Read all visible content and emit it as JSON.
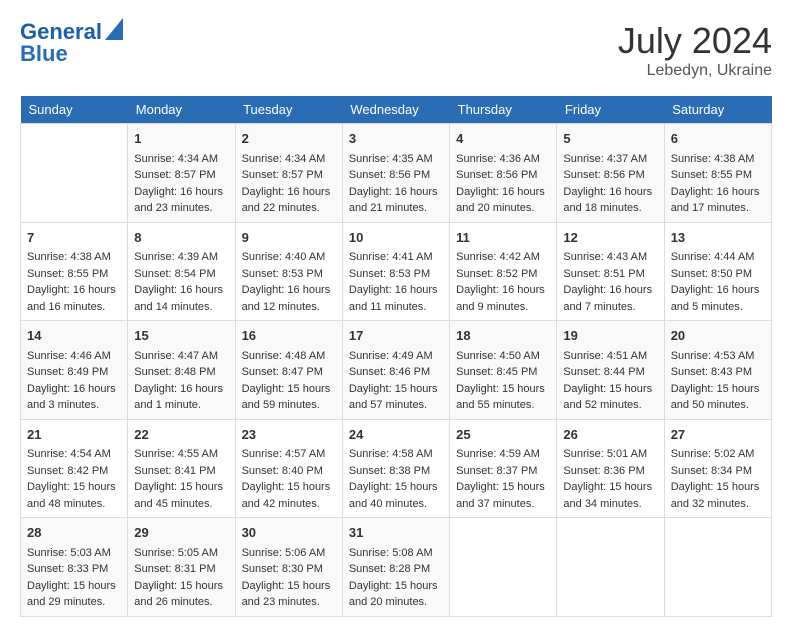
{
  "header": {
    "logo_line1": "General",
    "logo_line2": "Blue",
    "month_year": "July 2024",
    "location": "Lebedyn, Ukraine"
  },
  "calendar": {
    "days_of_week": [
      "Sunday",
      "Monday",
      "Tuesday",
      "Wednesday",
      "Thursday",
      "Friday",
      "Saturday"
    ],
    "weeks": [
      [
        {
          "day": "",
          "sunrise": "",
          "sunset": "",
          "daylight": ""
        },
        {
          "day": "1",
          "sunrise": "Sunrise: 4:34 AM",
          "sunset": "Sunset: 8:57 PM",
          "daylight": "Daylight: 16 hours and 23 minutes."
        },
        {
          "day": "2",
          "sunrise": "Sunrise: 4:34 AM",
          "sunset": "Sunset: 8:57 PM",
          "daylight": "Daylight: 16 hours and 22 minutes."
        },
        {
          "day": "3",
          "sunrise": "Sunrise: 4:35 AM",
          "sunset": "Sunset: 8:56 PM",
          "daylight": "Daylight: 16 hours and 21 minutes."
        },
        {
          "day": "4",
          "sunrise": "Sunrise: 4:36 AM",
          "sunset": "Sunset: 8:56 PM",
          "daylight": "Daylight: 16 hours and 20 minutes."
        },
        {
          "day": "5",
          "sunrise": "Sunrise: 4:37 AM",
          "sunset": "Sunset: 8:56 PM",
          "daylight": "Daylight: 16 hours and 18 minutes."
        },
        {
          "day": "6",
          "sunrise": "Sunrise: 4:38 AM",
          "sunset": "Sunset: 8:55 PM",
          "daylight": "Daylight: 16 hours and 17 minutes."
        }
      ],
      [
        {
          "day": "7",
          "sunrise": "Sunrise: 4:38 AM",
          "sunset": "Sunset: 8:55 PM",
          "daylight": "Daylight: 16 hours and 16 minutes."
        },
        {
          "day": "8",
          "sunrise": "Sunrise: 4:39 AM",
          "sunset": "Sunset: 8:54 PM",
          "daylight": "Daylight: 16 hours and 14 minutes."
        },
        {
          "day": "9",
          "sunrise": "Sunrise: 4:40 AM",
          "sunset": "Sunset: 8:53 PM",
          "daylight": "Daylight: 16 hours and 12 minutes."
        },
        {
          "day": "10",
          "sunrise": "Sunrise: 4:41 AM",
          "sunset": "Sunset: 8:53 PM",
          "daylight": "Daylight: 16 hours and 11 minutes."
        },
        {
          "day": "11",
          "sunrise": "Sunrise: 4:42 AM",
          "sunset": "Sunset: 8:52 PM",
          "daylight": "Daylight: 16 hours and 9 minutes."
        },
        {
          "day": "12",
          "sunrise": "Sunrise: 4:43 AM",
          "sunset": "Sunset: 8:51 PM",
          "daylight": "Daylight: 16 hours and 7 minutes."
        },
        {
          "day": "13",
          "sunrise": "Sunrise: 4:44 AM",
          "sunset": "Sunset: 8:50 PM",
          "daylight": "Daylight: 16 hours and 5 minutes."
        }
      ],
      [
        {
          "day": "14",
          "sunrise": "Sunrise: 4:46 AM",
          "sunset": "Sunset: 8:49 PM",
          "daylight": "Daylight: 16 hours and 3 minutes."
        },
        {
          "day": "15",
          "sunrise": "Sunrise: 4:47 AM",
          "sunset": "Sunset: 8:48 PM",
          "daylight": "Daylight: 16 hours and 1 minute."
        },
        {
          "day": "16",
          "sunrise": "Sunrise: 4:48 AM",
          "sunset": "Sunset: 8:47 PM",
          "daylight": "Daylight: 15 hours and 59 minutes."
        },
        {
          "day": "17",
          "sunrise": "Sunrise: 4:49 AM",
          "sunset": "Sunset: 8:46 PM",
          "daylight": "Daylight: 15 hours and 57 minutes."
        },
        {
          "day": "18",
          "sunrise": "Sunrise: 4:50 AM",
          "sunset": "Sunset: 8:45 PM",
          "daylight": "Daylight: 15 hours and 55 minutes."
        },
        {
          "day": "19",
          "sunrise": "Sunrise: 4:51 AM",
          "sunset": "Sunset: 8:44 PM",
          "daylight": "Daylight: 15 hours and 52 minutes."
        },
        {
          "day": "20",
          "sunrise": "Sunrise: 4:53 AM",
          "sunset": "Sunset: 8:43 PM",
          "daylight": "Daylight: 15 hours and 50 minutes."
        }
      ],
      [
        {
          "day": "21",
          "sunrise": "Sunrise: 4:54 AM",
          "sunset": "Sunset: 8:42 PM",
          "daylight": "Daylight: 15 hours and 48 minutes."
        },
        {
          "day": "22",
          "sunrise": "Sunrise: 4:55 AM",
          "sunset": "Sunset: 8:41 PM",
          "daylight": "Daylight: 15 hours and 45 minutes."
        },
        {
          "day": "23",
          "sunrise": "Sunrise: 4:57 AM",
          "sunset": "Sunset: 8:40 PM",
          "daylight": "Daylight: 15 hours and 42 minutes."
        },
        {
          "day": "24",
          "sunrise": "Sunrise: 4:58 AM",
          "sunset": "Sunset: 8:38 PM",
          "daylight": "Daylight: 15 hours and 40 minutes."
        },
        {
          "day": "25",
          "sunrise": "Sunrise: 4:59 AM",
          "sunset": "Sunset: 8:37 PM",
          "daylight": "Daylight: 15 hours and 37 minutes."
        },
        {
          "day": "26",
          "sunrise": "Sunrise: 5:01 AM",
          "sunset": "Sunset: 8:36 PM",
          "daylight": "Daylight: 15 hours and 34 minutes."
        },
        {
          "day": "27",
          "sunrise": "Sunrise: 5:02 AM",
          "sunset": "Sunset: 8:34 PM",
          "daylight": "Daylight: 15 hours and 32 minutes."
        }
      ],
      [
        {
          "day": "28",
          "sunrise": "Sunrise: 5:03 AM",
          "sunset": "Sunset: 8:33 PM",
          "daylight": "Daylight: 15 hours and 29 minutes."
        },
        {
          "day": "29",
          "sunrise": "Sunrise: 5:05 AM",
          "sunset": "Sunset: 8:31 PM",
          "daylight": "Daylight: 15 hours and 26 minutes."
        },
        {
          "day": "30",
          "sunrise": "Sunrise: 5:06 AM",
          "sunset": "Sunset: 8:30 PM",
          "daylight": "Daylight: 15 hours and 23 minutes."
        },
        {
          "day": "31",
          "sunrise": "Sunrise: 5:08 AM",
          "sunset": "Sunset: 8:28 PM",
          "daylight": "Daylight: 15 hours and 20 minutes."
        },
        {
          "day": "",
          "sunrise": "",
          "sunset": "",
          "daylight": ""
        },
        {
          "day": "",
          "sunrise": "",
          "sunset": "",
          "daylight": ""
        },
        {
          "day": "",
          "sunrise": "",
          "sunset": "",
          "daylight": ""
        }
      ]
    ]
  }
}
